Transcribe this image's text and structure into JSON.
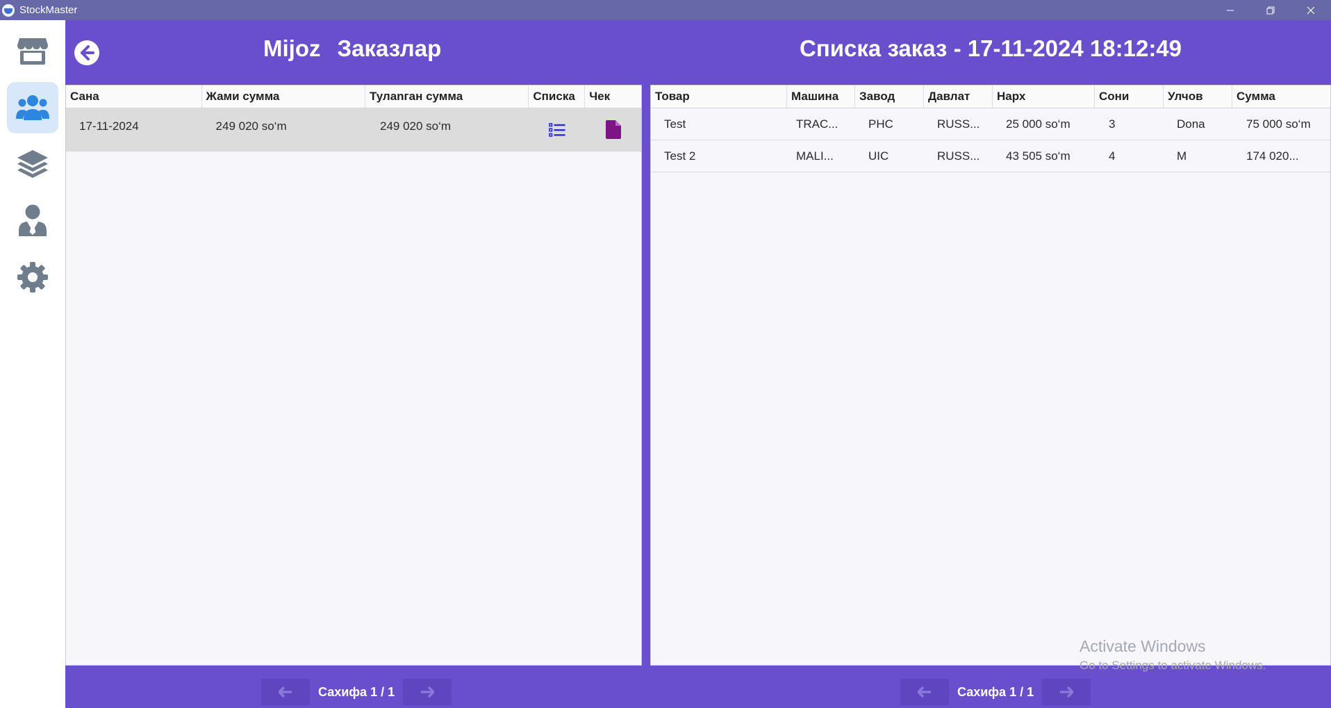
{
  "window": {
    "title": "StockMaster"
  },
  "sidebar": {
    "items": [
      {
        "name": "store",
        "icon": "store-icon",
        "active": false
      },
      {
        "name": "clients",
        "icon": "users-icon",
        "active": true
      },
      {
        "name": "layers",
        "icon": "layers-icon",
        "active": false
      },
      {
        "name": "staff",
        "icon": "user-tie-icon",
        "active": false
      },
      {
        "name": "settings",
        "icon": "gear-icon",
        "active": false
      }
    ]
  },
  "header": {
    "client_name": "Mijoz",
    "orders_title": "Заказлар",
    "details_title": "Списка заказ - 17-11-2024 18:12:49"
  },
  "orders_table": {
    "columns": [
      "Сана",
      "Жами сумма",
      "Тулanган сумма",
      "Списка",
      "Чек"
    ],
    "rows": [
      {
        "date": "17-11-2024",
        "total": "249 020 so‘m",
        "paid": "249 020 so‘m",
        "list_icon": "list-icon",
        "receipt_icon": "file-icon"
      }
    ]
  },
  "items_table": {
    "columns": [
      "Товар",
      "Машина",
      "Завод",
      "Давлат",
      "Нарх",
      "Сони",
      "Улчов",
      "Сумма"
    ],
    "rows": [
      {
        "product": "Test",
        "car": "TRAC...",
        "factory": "PHC",
        "country": "RUSS...",
        "price": "25 000 so‘m",
        "qty": "3",
        "unit": "Dona",
        "sum": "75 000 so‘m"
      },
      {
        "product": "Test 2",
        "car": "MALI...",
        "factory": "UIC",
        "country": "RUSS...",
        "price": "43 505 so‘m",
        "qty": "4",
        "unit": "M",
        "sum": "174 020..."
      }
    ]
  },
  "pagination_left": {
    "label": "Сахифа 1 / 1"
  },
  "pagination_right": {
    "label": "Сахифа 1 / 1"
  },
  "watermark": {
    "line1": "Activate Windows",
    "line2": "Go to Settings to activate Windows."
  },
  "colors": {
    "primary": "#6a4fcd",
    "titlebar": "#6668a8",
    "list_icon": "#2a2adb",
    "receipt_icon": "#7d1485",
    "active_nav": "#d8e8fa",
    "nav_icon": "#6f7d8c",
    "active_icon": "#2e86de"
  }
}
